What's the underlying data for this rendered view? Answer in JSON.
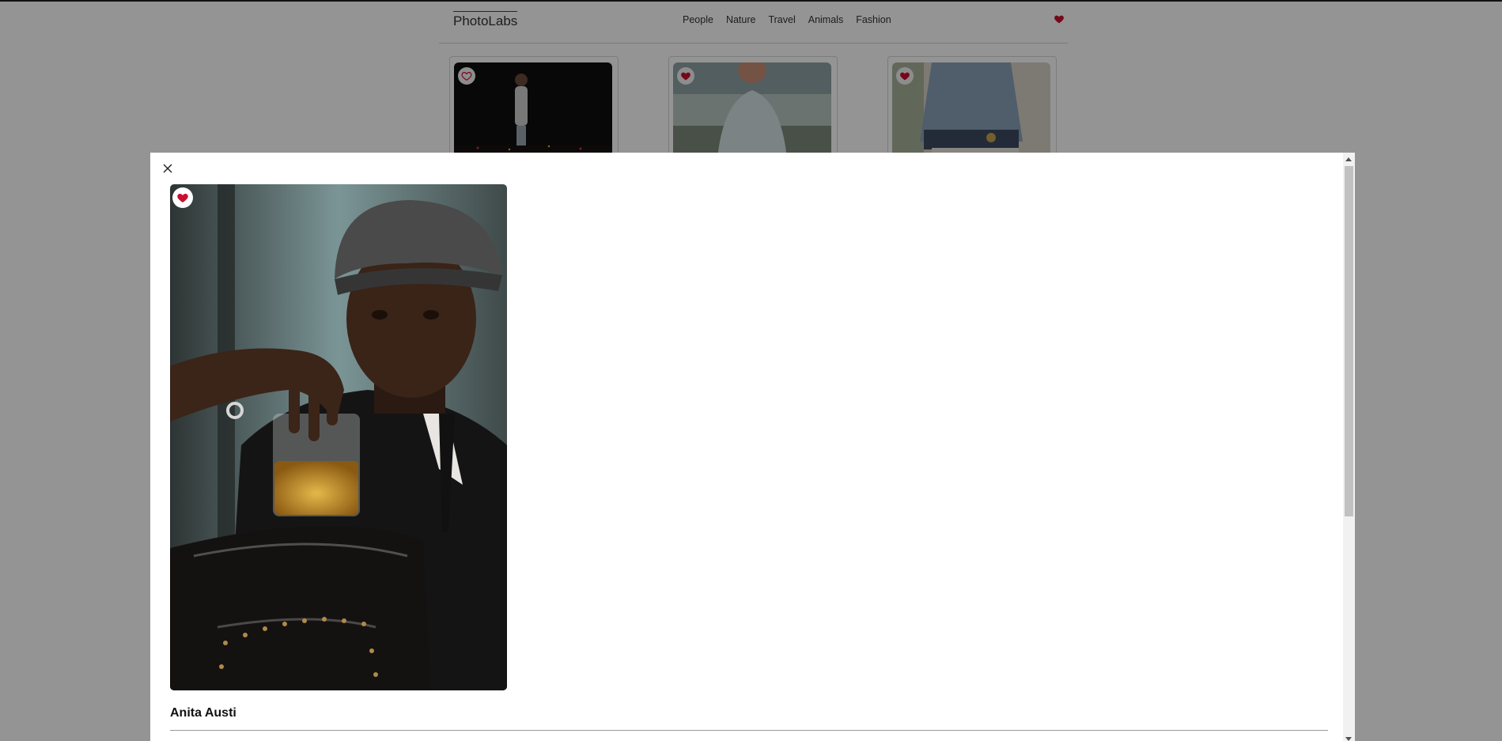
{
  "header": {
    "logo": "PhotoLabs",
    "topics": [
      "People",
      "Nature",
      "Travel",
      "Animals",
      "Fashion"
    ],
    "fav_icon": "heart-icon"
  },
  "grid": {
    "photos": [
      {
        "liked": false,
        "icon": "heart-outline-icon"
      },
      {
        "liked": true,
        "icon": "heart-filled-icon"
      },
      {
        "liked": true,
        "icon": "heart-filled-icon"
      }
    ]
  },
  "modal": {
    "close_icon": "close-icon",
    "photo_liked": true,
    "author_name": "Anita Austi"
  },
  "colors": {
    "accent_red": "#c8102e",
    "overlay": "rgba(0,0,0,0.42)"
  }
}
